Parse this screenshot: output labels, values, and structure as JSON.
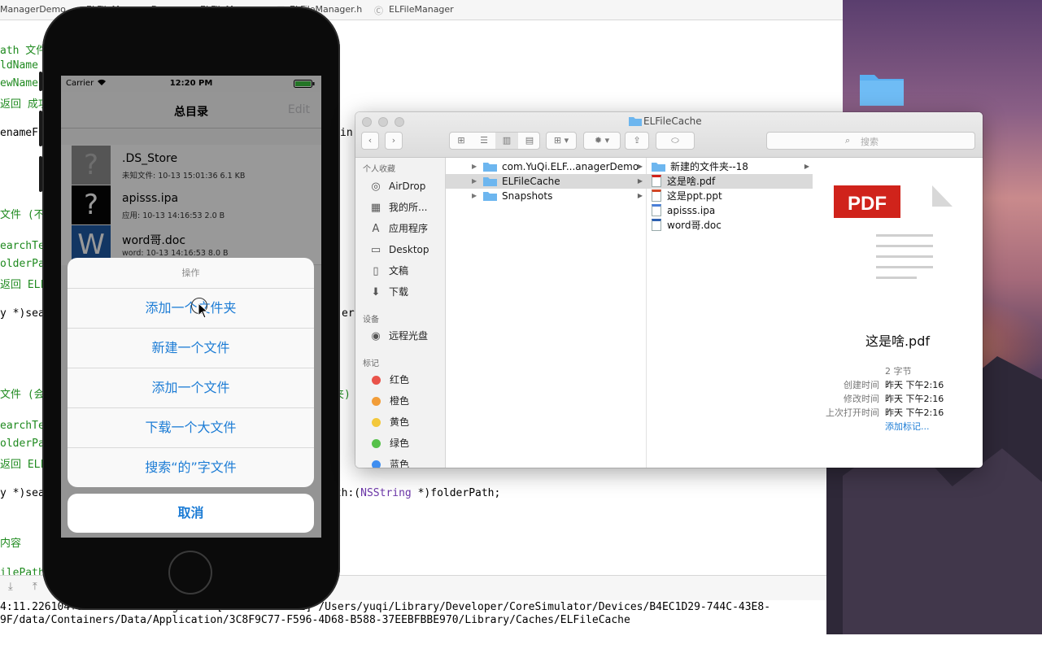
{
  "xcode": {
    "breadcrumb": [
      "ManagerDemo",
      "ELFileManagerDemo",
      "ELFileManager",
      "ELFileManager.h",
      "ELFileManager"
    ],
    "code_lines": [
      {
        "text": "ath 文件",
        "kind": "comment"
      },
      {
        "text": "ldName",
        "kind": "comment"
      },
      {
        "text": "ewName",
        "kind": "comment"
      },
      {
        "text": "返回 成功",
        "kind": "comment"
      },
      {
        "text": "enameF",
        "kind": "plain"
      },
      {
        "text": "文件 (不",
        "kind": "comment"
      },
      {
        "text": "earchTe",
        "kind": "comment"
      },
      {
        "text": "olderPa",
        "kind": "comment"
      },
      {
        "text": "返回 ELF",
        "kind": "comment"
      },
      {
        "text": "y *)sea",
        "kind": "plain"
      },
      {
        "text": "文件 (会",
        "kind": "comment"
      },
      {
        "text": "earchTe",
        "kind": "comment"
      },
      {
        "text": "olderPa",
        "kind": "comment"
      },
      {
        "text": "返回 ELF",
        "kind": "comment"
      },
      {
        "text": "y *)sea",
        "kind": "plain"
      },
      {
        "text": "内容",
        "kind": "comment"
      },
      {
        "text": "ilePath",
        "kind": "comment"
      }
    ],
    "right_fragments": {
      "in": "in",
      "er": "er",
      "fold_suffix": "夹)",
      "line_end_prefix": "ath:(",
      "line_end_type": "NSString",
      "line_end_rest": " *)folderPath;"
    },
    "console_lines": [
      "4:11.226104+0800 ELFileManagerDemo[48144:1938432] /Users/yuqi/Library/Developer/CoreSimulator/Devices/B4EC1D29-744C-43E8-",
      "9F/data/Containers/Data/Application/3C8F9C77-F596-4D68-B588-37EEBFBBE970/Library/Caches/ELFileCache"
    ]
  },
  "phone": {
    "status": {
      "carrier": "Carrier",
      "time": "12:20 PM"
    },
    "nav": {
      "title": "总目录",
      "edit": "Edit"
    },
    "files": [
      {
        "name": ".DS_Store",
        "meta": "未知文件:  10-13 15:01:36 6.1 KB",
        "icon": "?",
        "icon_name": "unknown-file-icon",
        "icon_bg": "#8e8e8e",
        "icon_fg": "#b8b8b8"
      },
      {
        "name": "apisss.ipa",
        "meta": "应用:  10-13 14:16:53 2.0 B",
        "icon": "?",
        "icon_name": "app-file-icon",
        "icon_bg": "#050505",
        "icon_fg": "#ffffff"
      },
      {
        "name": "word哥.doc",
        "meta": "word:  10-13 14:16:53 8.0 B",
        "icon": "W",
        "icon_name": "word-file-icon",
        "icon_bg": "#1f5aa5",
        "icon_fg": "#ffffff"
      }
    ],
    "sheet": {
      "title": "操作",
      "actions": [
        "添加一个文件夹",
        "新建一个文件",
        "添加一个文件",
        "下载一个大文件",
        "搜索“的”字文件"
      ],
      "cancel": "取消"
    }
  },
  "finder": {
    "title": "ELFileCache",
    "search_placeholder": "搜索",
    "sidebar": {
      "favorites_header": "个人收藏",
      "favorites": [
        {
          "label": "AirDrop",
          "icon": "airdrop-icon",
          "glyph": "◎"
        },
        {
          "label": "我的所...",
          "icon": "all-my-files-icon",
          "glyph": "▦"
        },
        {
          "label": "应用程序",
          "icon": "applications-icon",
          "glyph": "A"
        },
        {
          "label": "Desktop",
          "icon": "desktop-icon",
          "glyph": "▭"
        },
        {
          "label": "文稿",
          "icon": "documents-icon",
          "glyph": "▯"
        },
        {
          "label": "下载",
          "icon": "downloads-icon",
          "glyph": "⬇"
        }
      ],
      "devices_header": "设备",
      "devices": [
        {
          "label": "远程光盘",
          "icon": "remote-disc-icon",
          "glyph": "◉"
        }
      ],
      "tags_header": "标记",
      "tags": [
        {
          "label": "红色",
          "color": "#e9534a"
        },
        {
          "label": "橙色",
          "color": "#f29d38"
        },
        {
          "label": "黄色",
          "color": "#f3c83b"
        },
        {
          "label": "绿色",
          "color": "#56c14a"
        },
        {
          "label": "蓝色",
          "color": "#3f8ef0"
        }
      ]
    },
    "column1": [
      "com.YuQi.ELF...anagerDemo",
      "ELFileCache",
      "Snapshots"
    ],
    "column2": [
      {
        "name": "新建的文件夹--18",
        "type": "folder"
      },
      {
        "name": "这是啥.pdf",
        "type": "pdf"
      },
      {
        "name": "这是ppt.ppt",
        "type": "ppt"
      },
      {
        "name": "apisss.ipa",
        "type": "ipa"
      },
      {
        "name": "word哥.doc",
        "type": "doc"
      }
    ],
    "preview": {
      "badge": "PDF",
      "filename": "这是啥.pdf",
      "size": "2 字节",
      "info": [
        {
          "label": "创建时间",
          "value": "昨天 下午2:16"
        },
        {
          "label": "修改时间",
          "value": "昨天 下午2:16"
        },
        {
          "label": "上次打开时间",
          "value": "昨天 下午2:16"
        }
      ],
      "add_tags": "添加标记..."
    }
  },
  "colors": {
    "accent_blue": "#1c7cd5",
    "pdf_red": "#d0231b",
    "folder_blue": "#6db6ef",
    "code_comment": "#1f8a1f",
    "code_keyword": "#6c36a9"
  }
}
